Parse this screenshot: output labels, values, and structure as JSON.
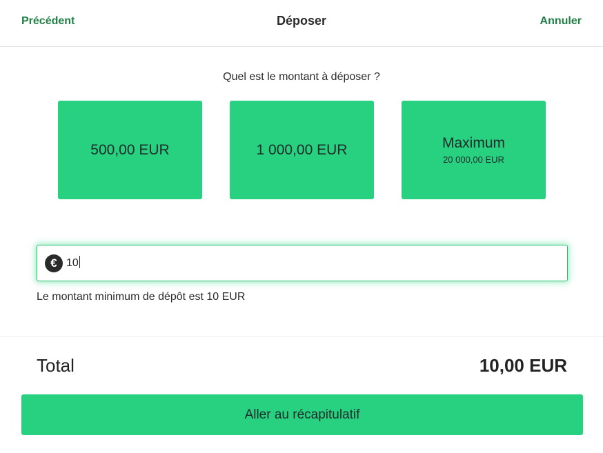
{
  "header": {
    "back_label": "Précédent",
    "title": "Déposer",
    "cancel_label": "Annuler"
  },
  "prompt": "Quel est le montant à déposer ?",
  "presets": [
    {
      "label": "500,00 EUR"
    },
    {
      "label": "1 000,00 EUR"
    },
    {
      "label": "Maximum",
      "sub": "20 000,00 EUR"
    }
  ],
  "amount_input": {
    "currency_symbol": "€",
    "value": "10"
  },
  "hint": "Le montant minimum de dépôt est 10 EUR",
  "total": {
    "label": "Total",
    "value": "10,00 EUR"
  },
  "cta_label": "Aller au récapitulatif",
  "colors": {
    "accent": "#27d17f",
    "link": "#1e7f45",
    "text": "#222222"
  }
}
